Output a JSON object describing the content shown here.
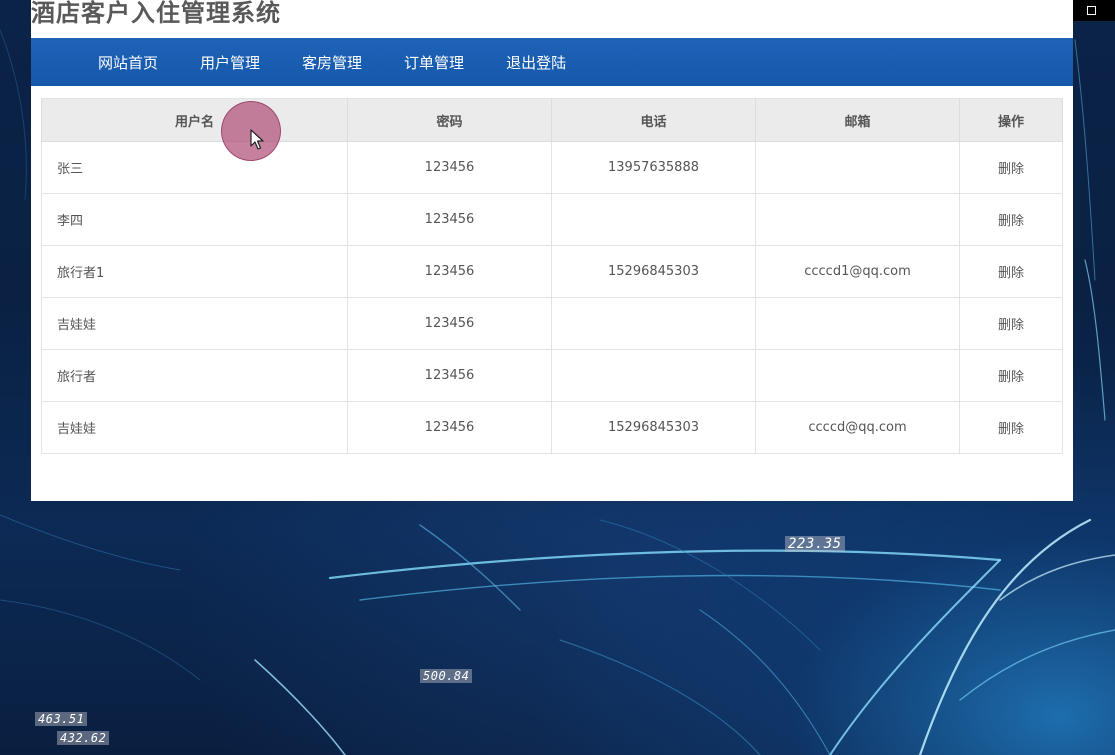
{
  "app_title": "酒店客户入住管理系统",
  "nav": [
    {
      "label": "网站首页"
    },
    {
      "label": "用户管理"
    },
    {
      "label": "客房管理"
    },
    {
      "label": "订单管理"
    },
    {
      "label": "退出登陆"
    }
  ],
  "table": {
    "headers": [
      "用户名",
      "密码",
      "电话",
      "邮箱",
      "操作"
    ],
    "rows": [
      {
        "username": "张三",
        "password": "123456",
        "phone": "13957635888",
        "email": "",
        "action": "删除"
      },
      {
        "username": "李四",
        "password": "123456",
        "phone": "",
        "email": "",
        "action": "删除"
      },
      {
        "username": "旅行者1",
        "password": "123456",
        "phone": "15296845303",
        "email": "ccccd1@qq.com",
        "action": "删除"
      },
      {
        "username": "吉娃娃",
        "password": "123456",
        "phone": "",
        "email": "",
        "action": "删除"
      },
      {
        "username": "旅行者",
        "password": "123456",
        "phone": "",
        "email": "",
        "action": "删除"
      },
      {
        "username": "吉娃娃",
        "password": "123456",
        "phone": "15296845303",
        "email": "ccccd@qq.com",
        "action": "删除"
      }
    ]
  },
  "background_numbers": [
    "223.35",
    "500.84",
    "463.51",
    "432.62"
  ],
  "colors": {
    "nav_bg": "#1558ab",
    "panel_bg": "#ffffff",
    "header_bg": "#ebebeb",
    "title_text": "#595959"
  },
  "icons": {
    "cursor": "mouse-pointer-icon",
    "minimize": "minimize-icon",
    "maximize": "maximize-icon"
  }
}
